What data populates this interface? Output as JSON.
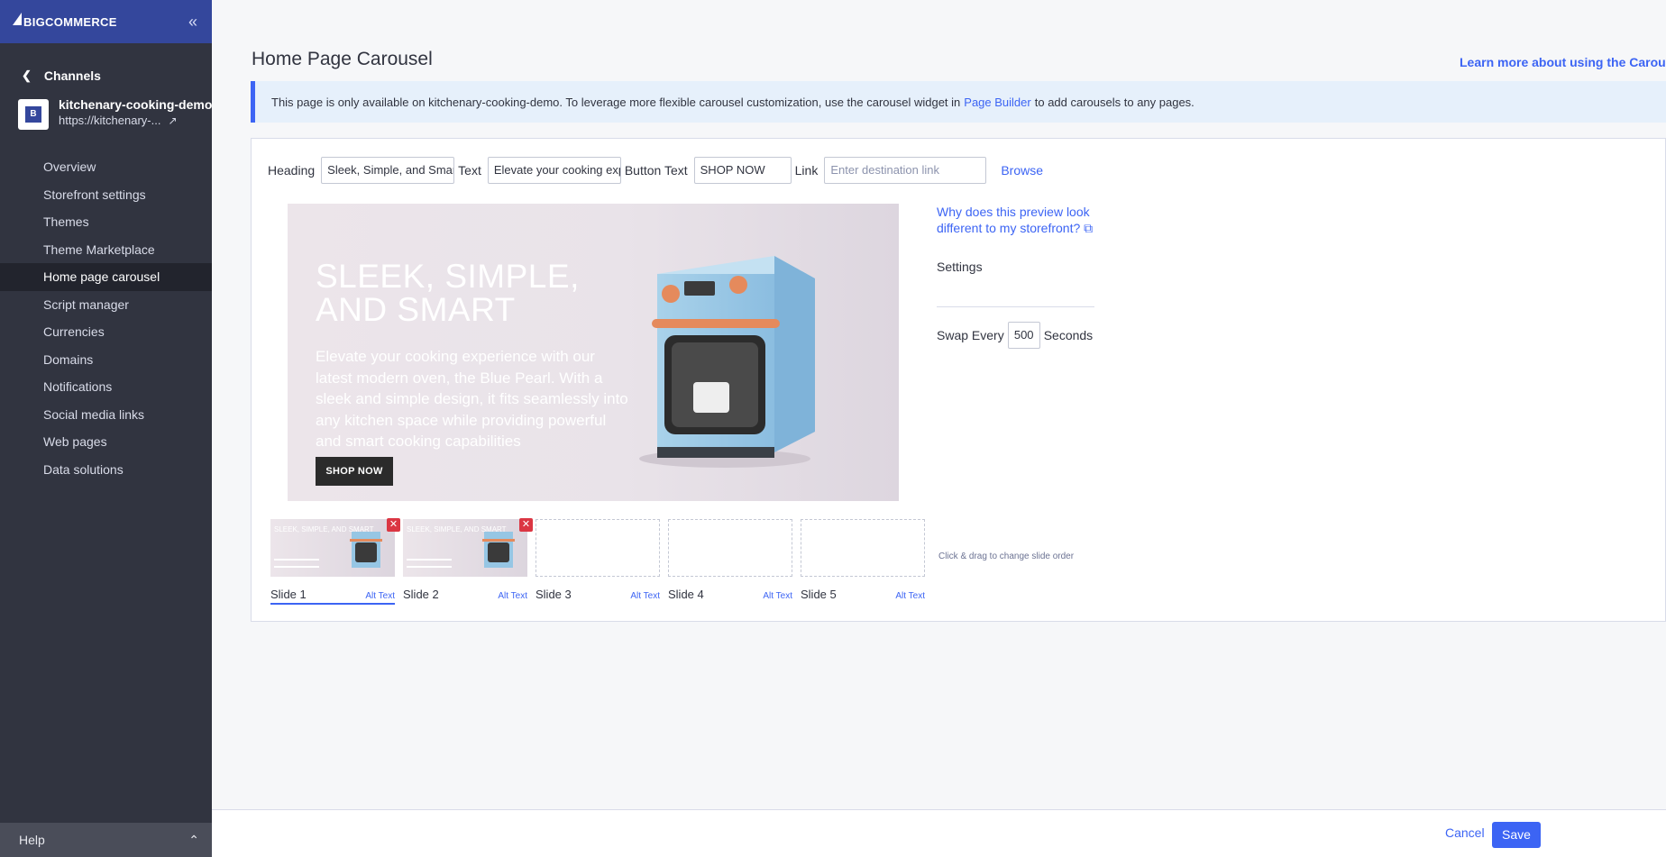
{
  "sidebar": {
    "logo": "BIGCOMMERCE",
    "back_label": "Channels",
    "store_name": "kitchenary-cooking-demo",
    "store_url": "https://kitchenary-...",
    "items": [
      {
        "label": "Overview"
      },
      {
        "label": "Storefront settings"
      },
      {
        "label": "Themes"
      },
      {
        "label": "Theme Marketplace"
      },
      {
        "label": "Home page carousel",
        "active": true
      },
      {
        "label": "Script manager"
      },
      {
        "label": "Currencies"
      },
      {
        "label": "Domains"
      },
      {
        "label": "Notifications"
      },
      {
        "label": "Social media links"
      },
      {
        "label": "Web pages"
      },
      {
        "label": "Data solutions"
      }
    ],
    "help_label": "Help"
  },
  "page": {
    "title": "Home Page Carousel",
    "learn_more": "Learn more about using the Carousel bu",
    "banner": {
      "before": "This page is only available on kitchenary-cooking-demo. To leverage more flexible carousel customization, use the carousel widget in",
      "link": "Page Builder",
      "after": "to add carousels to any pages."
    }
  },
  "fields": {
    "heading_label": "Heading",
    "heading_value": "Sleek, Simple, and Smart",
    "text_label": "Text",
    "text_value": "Elevate your cooking experience",
    "button_text_label": "Button Text",
    "button_text_value": "SHOP NOW",
    "link_label": "Link",
    "link_placeholder": "Enter destination link",
    "browse_label": "Browse"
  },
  "preview": {
    "heading": "SLEEK, SIMPLE, AND SMART",
    "text": "Elevate your cooking experience with our latest modern oven, the Blue Pearl. With a sleek and simple design, it fits seamlessly into any kitchen space while providing powerful and smart cooking capabilities",
    "button": "SHOP NOW"
  },
  "side": {
    "why_link": "Why does this preview look different to my storefront?",
    "settings_label": "Settings",
    "swap_label": "Swap Every",
    "swap_value": "500",
    "seconds_label": "Seconds"
  },
  "slides": [
    {
      "name": "Slide 1",
      "alt": "Alt Text",
      "filled": true,
      "active": true,
      "thumb_text": "SLEEK, SIMPLE, AND SMART"
    },
    {
      "name": "Slide 2",
      "alt": "Alt Text",
      "filled": true,
      "active": false,
      "thumb_text": "SLEEK, SIMPLE, AND SMART"
    },
    {
      "name": "Slide 3",
      "alt": "Alt Text",
      "filled": false,
      "active": false
    },
    {
      "name": "Slide 4",
      "alt": "Alt Text",
      "filled": false,
      "active": false
    },
    {
      "name": "Slide 5",
      "alt": "Alt Text",
      "filled": false,
      "active": false
    }
  ],
  "drag_hint": "Click & drag to change slide order",
  "footer": {
    "cancel_label": "Cancel",
    "save_label": "Save"
  },
  "colors": {
    "brand": "#34479c",
    "accent": "#3c64f4",
    "sidebar_bg": "#313440",
    "danger": "#db3643"
  }
}
